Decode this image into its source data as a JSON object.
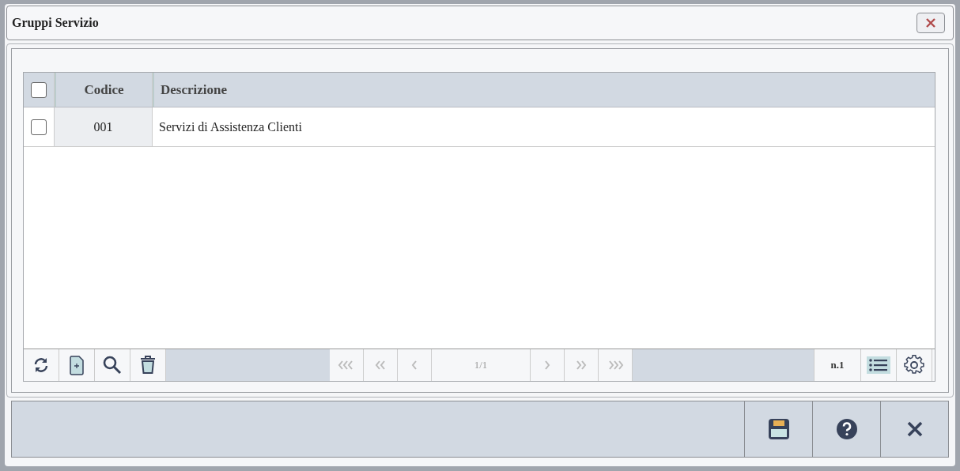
{
  "window": {
    "title": "Gruppi Servizio"
  },
  "table": {
    "select_all": {
      "checked": false
    },
    "columns": [
      "Codice",
      "Descrizione"
    ],
    "rows": [
      {
        "checked": false,
        "cells": [
          "001",
          "Servizi di Assistenza Clienti"
        ]
      }
    ]
  },
  "pager": {
    "page": "1/1",
    "count": "n.1",
    "list_view": {
      "selected": true
    }
  }
}
